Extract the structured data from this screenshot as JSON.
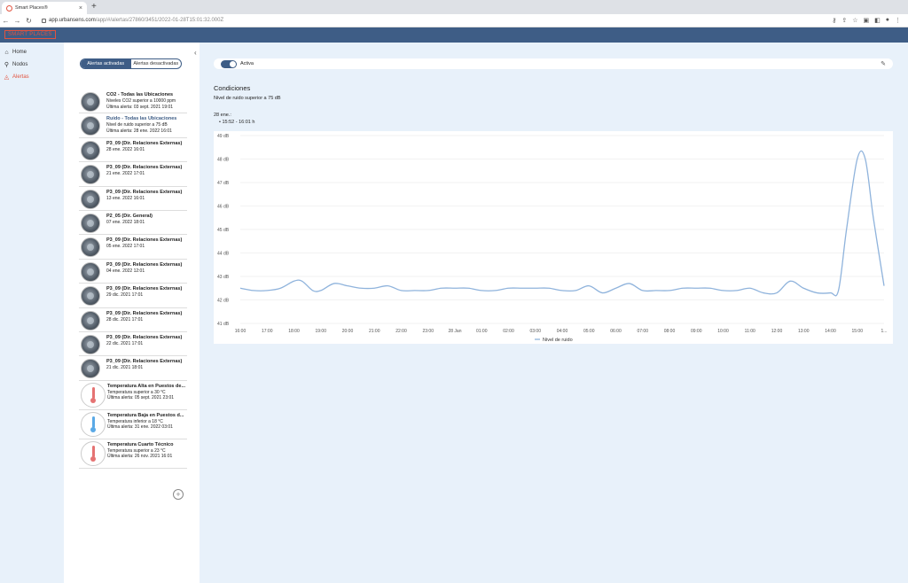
{
  "browser": {
    "tab_title": "Smart Places®",
    "tab_close": "×",
    "new_tab": "+",
    "url_host": "app.urbansens.com",
    "url_path": "/app/#/alertas/27860/3451/2022-01-28T15:01:32.000Z"
  },
  "app": {
    "logo_text": "SMART PLACES"
  },
  "nav": {
    "items": [
      {
        "label": "Home",
        "icon": "home-icon"
      },
      {
        "label": "Nodos",
        "icon": "node-icon"
      },
      {
        "label": "Alertas",
        "icon": "bell-icon"
      }
    ]
  },
  "list": {
    "tab_active": "Alertas activadas",
    "tab_inactive": "Alertas desactivadas",
    "add": "+",
    "alerts": [
      {
        "title": "CO2 - Todas las Ubicaciones",
        "lines": [
          "Niveles CO2 superior a 10000 ppm",
          "Última alerta: 03 sept. 2021 19:01"
        ]
      },
      {
        "title": "Ruido - Todas las Ubicaciones",
        "lines": [
          "Nivel de ruido superior a 75 dB",
          "Última alerta: 28 ene. 2022 16:01"
        ]
      },
      {
        "title": "P3_09 (Dir. Relaciones Externas)",
        "lines": [
          "",
          "28 ene. 2022 16:01"
        ]
      },
      {
        "title": "P3_09 (Dir. Relaciones Externas)",
        "lines": [
          "",
          "21 ene. 2022 17:01"
        ]
      },
      {
        "title": "P3_09 (Dir. Relaciones Externas)",
        "lines": [
          "",
          "13 ene. 2022 16:01"
        ]
      },
      {
        "title": "P2_05 (Dir. General)",
        "lines": [
          "",
          "07 ene. 2022 18:01"
        ]
      },
      {
        "title": "P3_09 (Dir. Relaciones Externas)",
        "lines": [
          "",
          "05 ene. 2022 17:01"
        ]
      },
      {
        "title": "P3_09 (Dir. Relaciones Externas)",
        "lines": [
          "",
          "04 ene. 2022 12:01"
        ]
      },
      {
        "title": "P3_09 (Dir. Relaciones Externas)",
        "lines": [
          "",
          "29 dic. 2021 17:01"
        ]
      },
      {
        "title": "P3_09 (Dir. Relaciones Externas)",
        "lines": [
          "",
          "28 dic. 2021 17:01"
        ]
      },
      {
        "title": "P3_09 (Dir. Relaciones Externas)",
        "lines": [
          "",
          "22 dic. 2021 17:01"
        ]
      },
      {
        "title": "P3_09 (Dir. Relaciones Externas)",
        "lines": [
          "",
          "21 dic. 2021 18:01"
        ]
      }
    ],
    "temp_alerts": [
      {
        "title": "Temperatura Alta en Puestos de...",
        "lines": [
          "Temperatura superior a 30 °C",
          "Última alerta: 05 sept. 2021 23:01"
        ],
        "color": "#e57373"
      },
      {
        "title": "Temperatura Baja en Puestos d...",
        "lines": [
          "Temperatura inferior a 18 °C",
          "Última alerta: 31 ene. 2022 03:01"
        ],
        "color": "#5aa9e6"
      },
      {
        "title": "Temperatura Cuarto Técnico",
        "lines": [
          "Temperatura superior a 23 °C",
          "Última alerta: 26 nov. 2021 16:01"
        ],
        "color": "#e57373"
      }
    ]
  },
  "main": {
    "active_label": "Activa",
    "conditions_title": "Condiciones",
    "conditions_desc": "Nivel de ruido superior a 75 dB",
    "date": "28 ene.:",
    "time_range": "•  15:52 - 16:01 h"
  },
  "colors": {
    "primary": "#3e5d86",
    "accent": "#e2533f",
    "line": "#8fb3dc"
  },
  "chart_data": {
    "type": "line",
    "x": [
      "16:00",
      "17:00",
      "18:00",
      "19:00",
      "20:00",
      "21:00",
      "22:00",
      "23:00",
      "28 Jan",
      "01:00",
      "02:00",
      "03:00",
      "04:00",
      "05:00",
      "06:00",
      "07:00",
      "08:00",
      "09:00",
      "10:00",
      "11:00",
      "12:00",
      "13:00",
      "14:00",
      "15:00",
      "1..."
    ],
    "ylim": [
      41,
      49
    ],
    "yticks": [
      "41 dB",
      "42 dB",
      "43 dB",
      "44 dB",
      "45 dB",
      "46 dB",
      "47 dB",
      "48 dB",
      "49 dB"
    ],
    "series": [
      {
        "name": "Nivel de ruido",
        "points": [
          [
            0,
            42.5
          ],
          [
            0.5,
            42.4
          ],
          [
            1,
            42.4
          ],
          [
            1.5,
            42.5
          ],
          [
            2,
            42.8
          ],
          [
            2.3,
            42.8
          ],
          [
            2.7,
            42.4
          ],
          [
            3,
            42.4
          ],
          [
            3.5,
            42.7
          ],
          [
            4,
            42.6
          ],
          [
            4.5,
            42.5
          ],
          [
            5,
            42.5
          ],
          [
            5.5,
            42.6
          ],
          [
            6,
            42.4
          ],
          [
            6.5,
            42.4
          ],
          [
            7,
            42.4
          ],
          [
            7.5,
            42.5
          ],
          [
            8,
            42.5
          ],
          [
            8.5,
            42.5
          ],
          [
            9,
            42.4
          ],
          [
            9.5,
            42.4
          ],
          [
            10,
            42.5
          ],
          [
            10.5,
            42.5
          ],
          [
            11,
            42.5
          ],
          [
            11.5,
            42.5
          ],
          [
            12,
            42.4
          ],
          [
            12.5,
            42.4
          ],
          [
            13,
            42.6
          ],
          [
            13.5,
            42.3
          ],
          [
            14,
            42.5
          ],
          [
            14.5,
            42.7
          ],
          [
            15,
            42.4
          ],
          [
            15.5,
            42.4
          ],
          [
            16,
            42.4
          ],
          [
            16.5,
            42.5
          ],
          [
            17,
            42.5
          ],
          [
            17.5,
            42.5
          ],
          [
            18,
            42.4
          ],
          [
            18.5,
            42.4
          ],
          [
            19,
            42.5
          ],
          [
            19.5,
            42.3
          ],
          [
            20,
            42.3
          ],
          [
            20.5,
            42.8
          ],
          [
            21,
            42.5
          ],
          [
            21.5,
            42.3
          ],
          [
            22,
            42.3
          ],
          [
            22.3,
            42.4
          ],
          [
            22.6,
            45.0
          ],
          [
            23,
            48.0
          ],
          [
            23.3,
            48.0
          ],
          [
            23.6,
            45.5
          ],
          [
            24,
            42.6
          ]
        ]
      }
    ]
  }
}
